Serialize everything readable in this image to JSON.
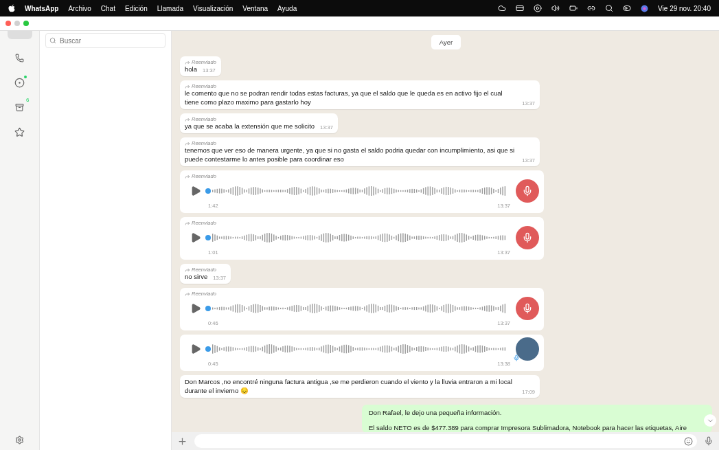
{
  "menu_bar": {
    "app": "WhatsApp",
    "items": [
      "Archivo",
      "Chat",
      "Edición",
      "Llamada",
      "Visualización",
      "Ventana",
      "Ayuda"
    ],
    "clock": "Vie 29 nov.  20:40"
  },
  "rail": {
    "items": [
      {
        "kind": "chats",
        "selected": true
      },
      {
        "kind": "calls",
        "selected": false
      },
      {
        "kind": "status",
        "selected": false,
        "dot": true
      },
      {
        "kind": "archived",
        "selected": false,
        "badge": "6"
      },
      {
        "kind": "starred",
        "selected": false
      }
    ]
  },
  "sidebar": {
    "search": {
      "placeholder": "Buscar"
    }
  },
  "chat": {
    "date_chip": "Ayer",
    "messages": [
      {
        "kind": "text",
        "forwarded_label": "Reenviado",
        "text": "hola",
        "time": "13:37"
      },
      {
        "kind": "text",
        "forwarded_label": "Reenviado",
        "text": "le comento que no se podran rendir todas estas facturas, ya que el saldo que le queda es en activo fijo el cual tiene como plazo maximo para gastarlo hoy",
        "time": "13:37"
      },
      {
        "kind": "text",
        "forwarded_label": "Reenviado",
        "text": "ya que se acaba la extensión que me solicito",
        "time": "13:37"
      },
      {
        "kind": "text",
        "forwarded_label": "Reenviado",
        "text": "tenemos que ver eso de manera urgente, ya que si no gasta el saldo podria quedar con incumplimiento, asi que si puede contestarme lo antes posible para coordinar eso",
        "time": "13:37"
      },
      {
        "kind": "voice",
        "forwarded_label": "Reenviado",
        "duration": "1:42",
        "time": "13:37",
        "photo_avatar": false
      },
      {
        "kind": "voice",
        "forwarded_label": "Reenviado",
        "duration": "1:01",
        "time": "13:37",
        "photo_avatar": false
      },
      {
        "kind": "text",
        "forwarded_label": "Reenviado",
        "text": "no sirve",
        "time": "13:37"
      },
      {
        "kind": "voice",
        "forwarded_label": "Reenviado",
        "duration": "0:46",
        "time": "13:37",
        "photo_avatar": false
      },
      {
        "kind": "voice",
        "duration": "0:45",
        "time": "13:38",
        "photo_avatar": true
      },
      {
        "kind": "text",
        "text": "Don Marcos ,no encontré ninguna factura antigua ,se me perdieron cuando el viento y la lluvia entraron a mi local durante el invierno 😔",
        "time": "17:09"
      }
    ],
    "outgoing": {
      "lines": [
        "Don Rafael, le dejo una pequeña información.",
        "El saldo NETO es de $477.389 para comprar Impresora Sublimadora, Notebook para hacer las etiquetas, Aire"
      ]
    }
  }
}
